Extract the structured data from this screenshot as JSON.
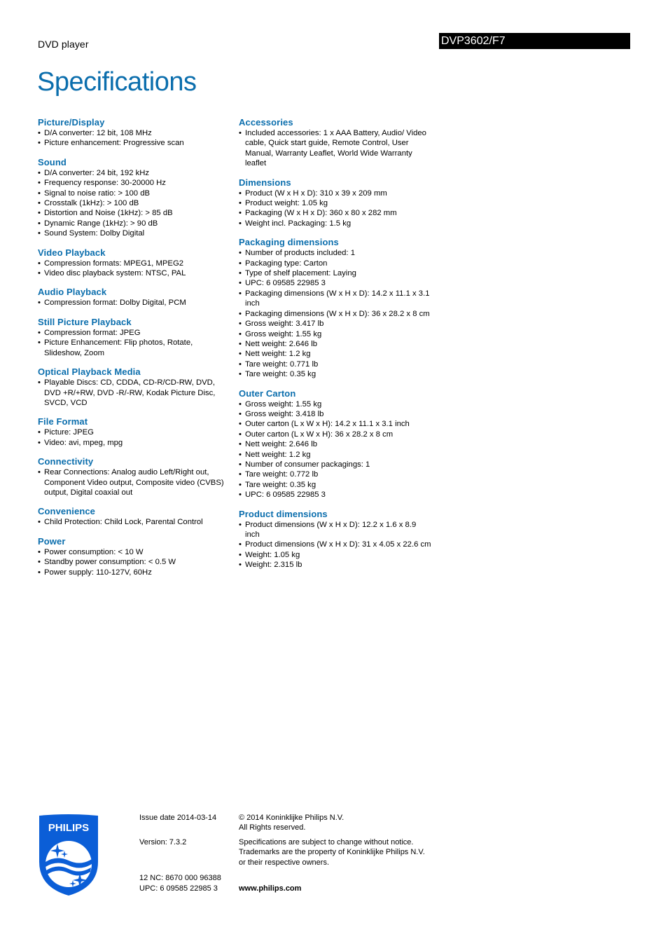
{
  "header": {
    "category": "DVD player",
    "model": "DVP3602/F7",
    "title": "Specifications"
  },
  "colors": {
    "accent": "#0b6ead",
    "model_bar": "#000000"
  },
  "left_column": [
    {
      "title": "Picture/Display",
      "items": [
        "D/A converter: 12 bit, 108 MHz",
        "Picture enhancement: Progressive scan"
      ]
    },
    {
      "title": "Sound",
      "items": [
        "D/A converter: 24 bit, 192 kHz",
        "Frequency response: 30-20000 Hz",
        "Signal to noise ratio: > 100 dB",
        "Crosstalk (1kHz): > 100 dB",
        "Distortion and Noise (1kHz): > 85 dB",
        "Dynamic Range (1kHz): > 90 dB",
        "Sound System: Dolby Digital"
      ]
    },
    {
      "title": "Video Playback",
      "items": [
        "Compression formats: MPEG1, MPEG2",
        "Video disc playback system: NTSC, PAL"
      ]
    },
    {
      "title": "Audio Playback",
      "items": [
        "Compression format: Dolby Digital, PCM"
      ]
    },
    {
      "title": "Still Picture Playback",
      "items": [
        "Compression format: JPEG",
        "Picture Enhancement: Flip photos, Rotate, Slideshow, Zoom"
      ]
    },
    {
      "title": "Optical Playback Media",
      "items": [
        "Playable Discs: CD, CDDA, CD-R/CD-RW, DVD, DVD +R/+RW, DVD -R/-RW, Kodak Picture Disc, SVCD, VCD"
      ]
    },
    {
      "title": "File Format",
      "items": [
        "Picture: JPEG",
        "Video: avi, mpeg, mpg"
      ]
    },
    {
      "title": "Connectivity",
      "items": [
        "Rear Connections: Analog audio Left/Right out, Component Video output, Composite video (CVBS) output, Digital coaxial out"
      ]
    },
    {
      "title": "Convenience",
      "items": [
        "Child Protection: Child Lock, Parental Control"
      ]
    },
    {
      "title": "Power",
      "items": [
        "Power consumption: < 10 W",
        "Standby power consumption: < 0.5 W",
        "Power supply: 110-127V, 60Hz"
      ]
    }
  ],
  "right_column": [
    {
      "title": "Accessories",
      "items": [
        "Included accessories: 1 x AAA Battery, Audio/ Video cable, Quick start guide, Remote Control, User Manual, Warranty Leaflet, World Wide Warranty leaflet"
      ]
    },
    {
      "title": "Dimensions",
      "items": [
        "Product (W x H x D): 310 x 39 x 209 mm",
        "Product weight: 1.05 kg",
        "Packaging (W x H x D): 360 x 80 x 282 mm",
        "Weight incl. Packaging: 1.5 kg"
      ]
    },
    {
      "title": "Packaging dimensions",
      "items": [
        "Number of products included: 1",
        "Packaging type: Carton",
        "Type of shelf placement: Laying",
        "UPC: 6 09585 22985 3",
        "Packaging dimensions (W x H x D): 14.2 x 11.1 x 3.1 inch",
        "Packaging dimensions (W x H x D): 36 x 28.2 x 8 cm",
        "Gross weight: 3.417 lb",
        "Gross weight: 1.55 kg",
        "Nett weight: 2.646 lb",
        "Nett weight: 1.2 kg",
        "Tare weight: 0.771 lb",
        "Tare weight: 0.35 kg"
      ]
    },
    {
      "title": "Outer Carton",
      "items": [
        "Gross weight: 1.55 kg",
        "Gross weight: 3.418 lb",
        "Outer carton (L x W x H): 14.2 x 11.1 x 3.1 inch",
        "Outer carton (L x W x H): 36 x 28.2 x 8 cm",
        "Nett weight: 2.646 lb",
        "Nett weight: 1.2 kg",
        "Number of consumer packagings: 1",
        "Tare weight: 0.772 lb",
        "Tare weight: 0.35 kg",
        "UPC: 6 09585 22985 3"
      ]
    },
    {
      "title": "Product dimensions",
      "items": [
        "Product dimensions (W x H x D): 12.2 x 1.6 x 8.9 inch",
        "Product dimensions (W x H x D): 31 x 4.05 x 22.6 cm",
        "Weight: 1.05 kg",
        "Weight: 2.315 lb"
      ]
    }
  ],
  "footer": {
    "logo_text": "PHILIPS",
    "issue_date": "Issue date 2014-03-14",
    "version": "Version: 7.3.2",
    "nc": "12 NC: 8670 000 96388",
    "upc": "UPC: 6 09585 22985 3",
    "copyright_line1": "© 2014 Koninklijke Philips N.V.",
    "copyright_line2": "All Rights reserved.",
    "spec_line1": "Specifications are subject to change without notice.",
    "spec_line2": "Trademarks are the property of Koninklijke Philips N.V.",
    "spec_line3": "or their respective owners.",
    "website": "www.philips.com"
  }
}
